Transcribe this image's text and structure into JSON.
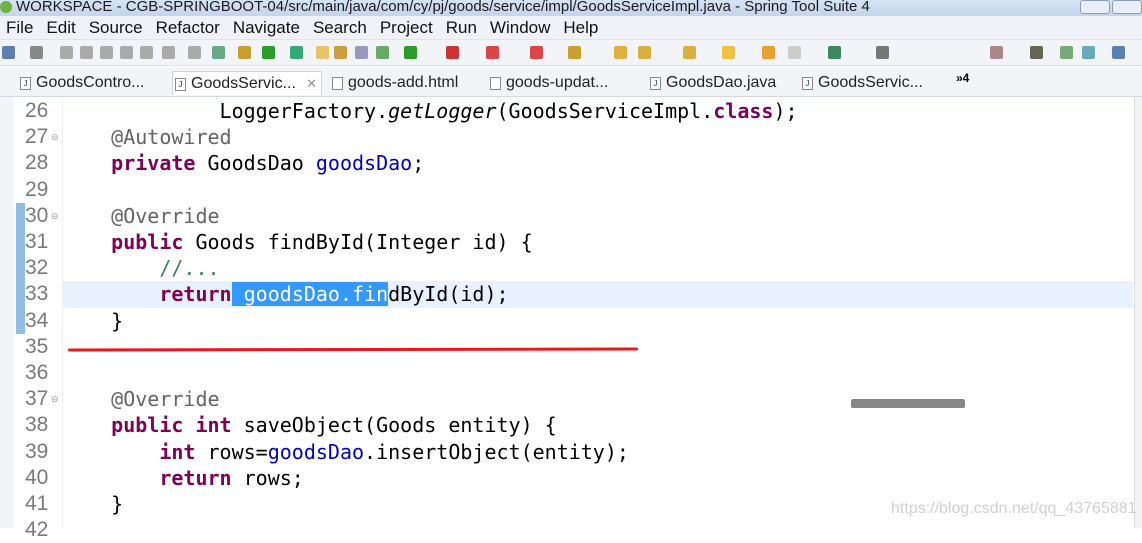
{
  "window": {
    "title": "WORKSPACE - CGB-SPRINGBOOT-04/src/main/java/com/cy/pj/goods/service/impl/GoodsServiceImpl.java - Spring Tool Suite 4"
  },
  "menu": [
    "File",
    "Edit",
    "Source",
    "Refactor",
    "Navigate",
    "Search",
    "Project",
    "Run",
    "Window",
    "Help"
  ],
  "tabs": [
    {
      "label": "GoodsContro...",
      "icon": "java-file-icon"
    },
    {
      "label": "GoodsServic...",
      "icon": "java-file-icon",
      "active": true
    },
    {
      "label": "goods-add.html",
      "icon": "html-file-icon"
    },
    {
      "label": "goods-updat...",
      "icon": "html-file-icon"
    },
    {
      "label": "GoodsDao.java",
      "icon": "java-file-icon"
    },
    {
      "label": "GoodsServic...",
      "icon": "java-file-icon"
    }
  ],
  "tabs_overflow": "»4",
  "editor": {
    "lines": [
      {
        "n": "26",
        "tokens": [
          [
            "             ",
            ""
          ],
          [
            "LoggerFactory.",
            ""
          ],
          [
            "getLogger",
            "it"
          ],
          [
            "(GoodsServiceImpl.",
            ""
          ],
          [
            "class",
            "kw"
          ],
          [
            ");",
            ""
          ]
        ]
      },
      {
        "n": "27",
        "fold": true,
        "tokens": [
          [
            "    ",
            ""
          ],
          [
            "@Autowired",
            "ann"
          ]
        ]
      },
      {
        "n": "28",
        "tokens": [
          [
            "    ",
            ""
          ],
          [
            "private",
            "kw"
          ],
          [
            " GoodsDao ",
            ""
          ],
          [
            "goodsDao",
            "field"
          ],
          [
            ";",
            ""
          ]
        ]
      },
      {
        "n": "29",
        "tokens": []
      },
      {
        "n": "30",
        "fold": true,
        "tokens": [
          [
            "    ",
            ""
          ],
          [
            "@Override",
            "ann"
          ]
        ]
      },
      {
        "n": "31",
        "tokens": [
          [
            "    ",
            ""
          ],
          [
            "public",
            "kw"
          ],
          [
            " Goods findById(Integer id) {",
            ""
          ]
        ]
      },
      {
        "n": "32",
        "tokens": [
          [
            "        ",
            ""
          ],
          [
            "//...",
            "cmt"
          ]
        ]
      },
      {
        "n": "33",
        "current": true,
        "tokens": [
          [
            "        ",
            ""
          ],
          [
            "return",
            "kw"
          ],
          [
            " goodsDao.fin",
            "sel"
          ],
          [
            "dById(id);",
            ""
          ]
        ]
      },
      {
        "n": "34",
        "tokens": [
          [
            "    }",
            ""
          ]
        ]
      },
      {
        "n": "35",
        "tokens": []
      },
      {
        "n": "36",
        "tokens": []
      },
      {
        "n": "37",
        "fold": true,
        "tokens": [
          [
            "    ",
            ""
          ],
          [
            "@Override",
            "ann"
          ]
        ]
      },
      {
        "n": "38",
        "tokens": [
          [
            "    ",
            ""
          ],
          [
            "public",
            "kw"
          ],
          [
            " ",
            ""
          ],
          [
            "int",
            "kw"
          ],
          [
            " saveObject(Goods entity) {",
            ""
          ]
        ]
      },
      {
        "n": "39",
        "tokens": [
          [
            "        ",
            ""
          ],
          [
            "int",
            "kw"
          ],
          [
            " rows=",
            ""
          ],
          [
            "goodsDao",
            "field"
          ],
          [
            ".insertObject(entity);",
            ""
          ]
        ]
      },
      {
        "n": "40",
        "tokens": [
          [
            "        ",
            ""
          ],
          [
            "return",
            "kw"
          ],
          [
            " rows;",
            ""
          ]
        ]
      },
      {
        "n": "41",
        "tokens": [
          [
            "    }",
            ""
          ]
        ]
      },
      {
        "n": "42",
        "tokens": []
      }
    ]
  },
  "colors": {
    "keyword": "#7f0055",
    "annotation": "#646464",
    "field": "#0000c0",
    "comment": "#3f7f5f",
    "selection": "#3399ff",
    "annotation_stroke": "#e8191a"
  },
  "watermark": "https://blog.csdn.net/qq_43765881"
}
